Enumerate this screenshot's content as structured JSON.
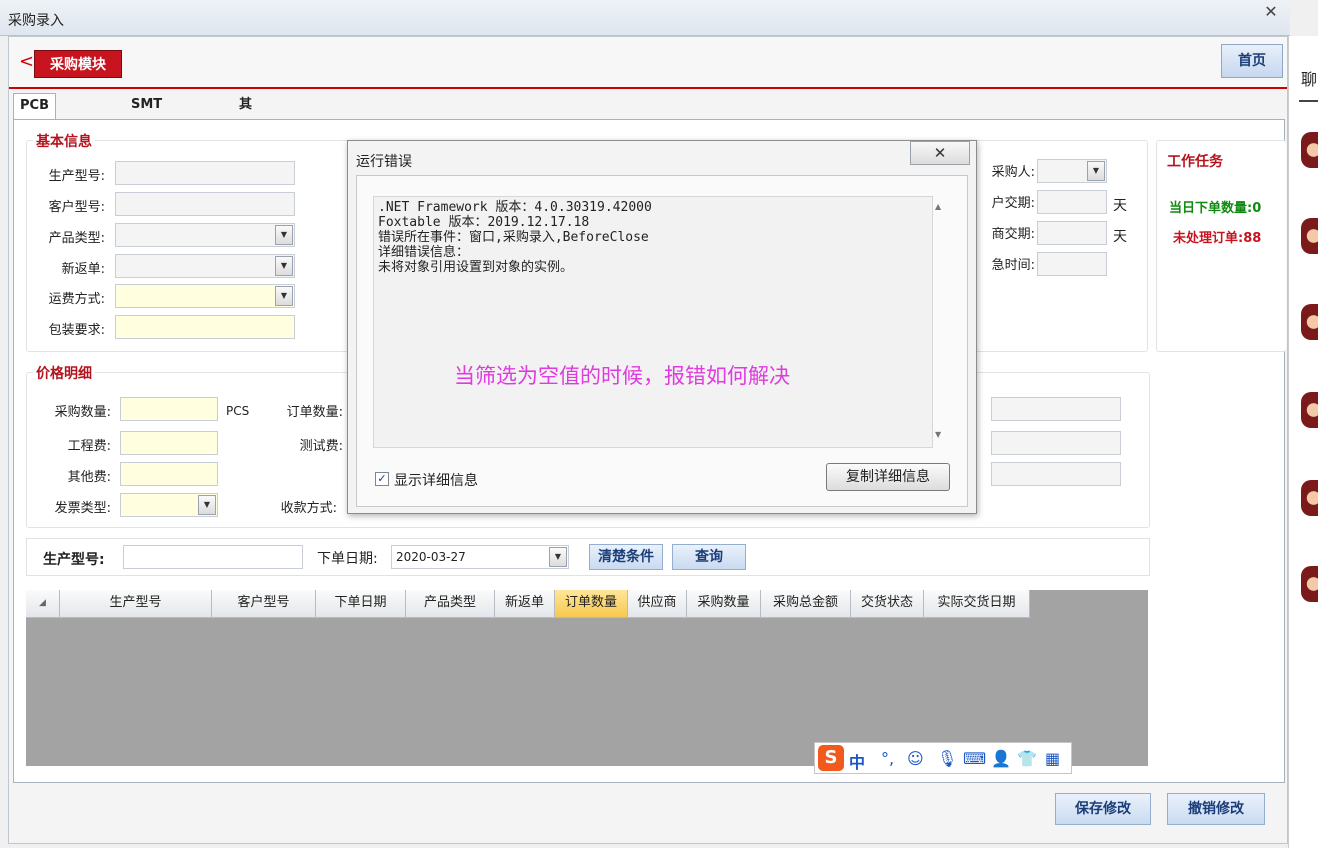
{
  "window": {
    "title": "采购录入",
    "close_glyph": "✕"
  },
  "right_panel": {
    "label": "聊"
  },
  "module": {
    "back_glyph": "<",
    "title": "采购模块",
    "home_label": "首页"
  },
  "tabs": [
    {
      "label": "PCB采购录入",
      "active": true
    },
    {
      "label": "SMT采购录入",
      "active": false
    },
    {
      "label": "其他采购",
      "active": false
    }
  ],
  "basic_info": {
    "title": "基本信息",
    "fields": {
      "production_model": {
        "label": "生产型号:",
        "value": ""
      },
      "customer_model": {
        "label": "客户型号:",
        "value": ""
      },
      "product_type": {
        "label": "产品类型:",
        "value": ""
      },
      "new_return": {
        "label": "新返单:",
        "value": ""
      },
      "freight_method": {
        "label": "运费方式:",
        "value": ""
      },
      "packaging": {
        "label": "包装要求:",
        "value": ""
      },
      "purchaser": {
        "label": "采购人:",
        "value": ""
      },
      "customer_delivery": {
        "label": "户交期:",
        "value": "",
        "unit": "天"
      },
      "supplier_delivery": {
        "label": "商交期:",
        "value": "",
        "unit": "天"
      },
      "urgent_time": {
        "label": "急时间:",
        "value": ""
      }
    }
  },
  "work_tasks": {
    "title": "工作任务",
    "today_orders": "当日下单数量:0",
    "pending_orders": "未处理订单:88"
  },
  "price_detail": {
    "title": "价格明细",
    "fields": {
      "purchase_qty": {
        "label": "采购数量:",
        "value": "",
        "unit": "PCS"
      },
      "engineering_fee": {
        "label": "工程费:",
        "value": ""
      },
      "other_fee": {
        "label": "其他费:",
        "value": ""
      },
      "invoice_type": {
        "label": "发票类型:",
        "value": ""
      },
      "order_qty": {
        "label": "订单数量:",
        "value": ""
      },
      "test_fee": {
        "label": "测试费:",
        "value": ""
      },
      "payment_method": {
        "label": "收款方式:",
        "value": ""
      }
    }
  },
  "filter": {
    "production_model_label": "生产型号:",
    "production_model_value": "",
    "order_date_label": "下单日期:",
    "order_date_value": "2020-03-27",
    "clear_label": "清楚条件",
    "query_label": "查询"
  },
  "grid": {
    "corner_glyph": "◢",
    "columns": [
      "生产型号",
      "客户型号",
      "下单日期",
      "产品类型",
      "新返单",
      "订单数量",
      "供应商",
      "采购数量",
      "采购总金额",
      "交货状态",
      "实际交货日期"
    ],
    "sorted_column": "订单数量"
  },
  "ime_toolbar": {
    "logo": "S",
    "mode": "中",
    "icons": [
      "punctuation-icon",
      "emoji-icon",
      "microphone-icon",
      "keyboard-icon",
      "user-icon",
      "skin-icon",
      "apps-icon"
    ]
  },
  "bottom": {
    "save_label": "保存修改",
    "undo_label": "撤销修改"
  },
  "dialog": {
    "title": "运行错误",
    "close_glyph": "✕",
    "lines": [
      ".NET Framework 版本：4.0.30319.42000",
      "Foxtable 版本：2019.12.17.18",
      "错误所在事件：窗口,采购录入,BeforeClose",
      "详细错误信息：",
      "未将对象引用设置到对象的实例。"
    ],
    "annotation": "当筛选为空值的时候，报错如何解决",
    "show_details_label": "显示详细信息",
    "show_details_checked": true,
    "copy_label": "复制详细信息"
  },
  "colors": {
    "accent_red": "#c8141e",
    "task_green": "#118a11",
    "annotation_magenta": "#e03be0",
    "input_yellow": "#ffffe0",
    "sorted_header": "#f7c84e"
  }
}
